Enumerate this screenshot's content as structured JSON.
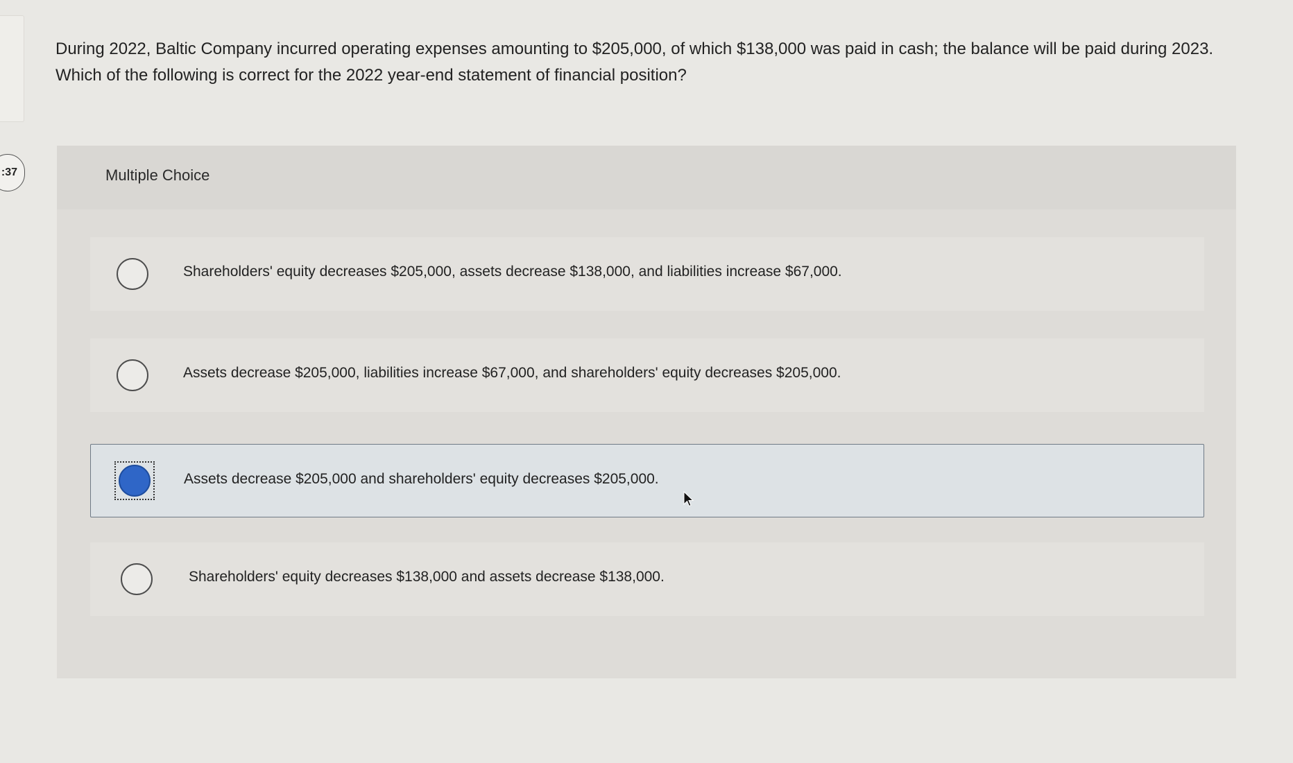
{
  "sidebar": {
    "timer_text": ":37"
  },
  "question": {
    "text": "During 2022, Baltic Company incurred operating expenses amounting to $205,000, of which $138,000 was paid in cash; the balance will be paid during 2023. Which of the following is correct for the 2022 year-end statement of financial position?"
  },
  "multiple_choice": {
    "title": "Multiple Choice",
    "options": [
      {
        "label": "Shareholders' equity decreases $205,000, assets decrease $138,000, and liabilities increase $67,000.",
        "selected": false
      },
      {
        "label": "Assets decrease $205,000, liabilities increase $67,000, and shareholders' equity decreases $205,000.",
        "selected": false
      },
      {
        "label": "Assets decrease $205,000 and shareholders' equity decreases $205,000.",
        "selected": true
      },
      {
        "label": "Shareholders' equity decreases $138,000 and assets decrease $138,000.",
        "selected": false
      }
    ]
  },
  "colors": {
    "selected_radio": "#2f66c7",
    "selected_bg": "#dde2e5"
  },
  "icons": {
    "cursor": "mouse-pointer-icon"
  }
}
